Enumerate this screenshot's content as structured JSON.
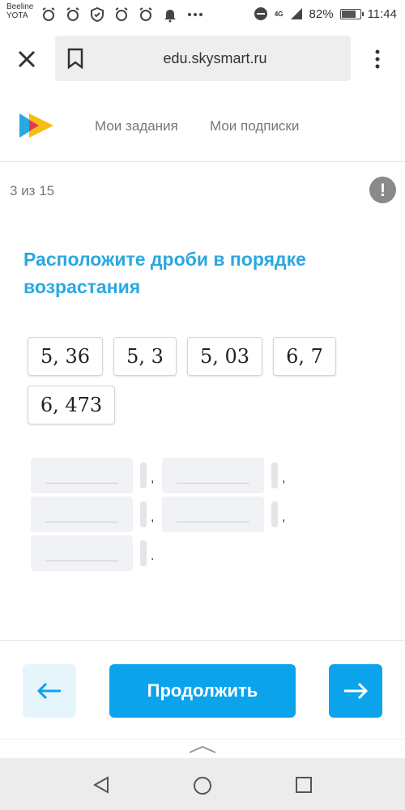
{
  "status_bar": {
    "carrier_line1": "Beeline",
    "carrier_line2": "YOTA",
    "network": "4G",
    "battery_percent": "82%",
    "battery_level": 0.82,
    "time": "11:44",
    "icons": [
      "alarm-icon",
      "alarm-icon",
      "alarm-icon",
      "shield-icon",
      "alarm-icon",
      "alarm-icon",
      "bell-icon",
      "more-dots-icon",
      "do-not-disturb-icon",
      "signal-icon",
      "battery-icon"
    ]
  },
  "browser": {
    "url": "edu.skysmart.ru",
    "icons": [
      "close-icon",
      "bookmark-icon",
      "kebab-menu-icon"
    ]
  },
  "header": {
    "nav": [
      "Мои задания",
      "Мои подписки"
    ],
    "logo_colors": [
      "#2aa8e0",
      "#f5b800",
      "#e8344f"
    ]
  },
  "task": {
    "progress": "3 из 15",
    "report_icon_label": "!",
    "title": "Расположите дроби в порядке возрастания",
    "fractions": [
      "5, 36",
      "5, 3",
      "5, 03",
      "6, 7",
      "6, 473"
    ],
    "separators": [
      ",",
      ",",
      ",",
      ",",
      "."
    ]
  },
  "footer": {
    "continue_label": "Продолжить",
    "accent_color": "#0ba4ec"
  }
}
